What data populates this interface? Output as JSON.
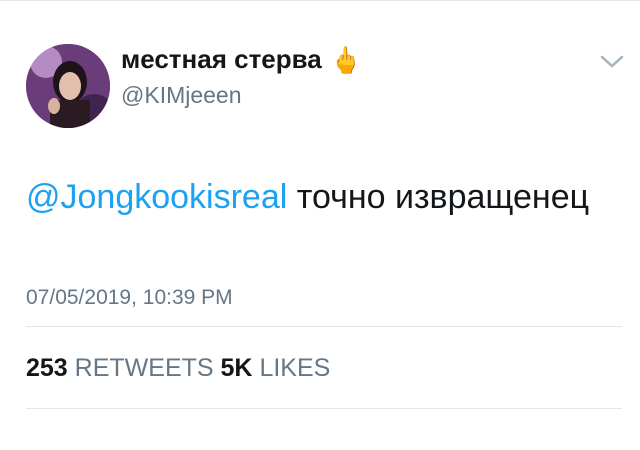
{
  "tweet": {
    "display_name": "местная стерва",
    "name_emoji": "🖕",
    "handle": "@KIMjeeen",
    "mention": "@Jongkookisreal",
    "text_after_mention": " точно извращенец",
    "timestamp": "07/05/2019, 10:39 PM",
    "stats": {
      "retweets_count": "253",
      "retweets_label": "RETWEETS",
      "likes_count": "5K",
      "likes_label": "LIKES"
    }
  },
  "icons": {
    "menu": "chevron-down-icon",
    "avatar": "avatar"
  },
  "colors": {
    "link": "#1da1f2",
    "secondary_text": "#657786",
    "primary_text": "#14171a",
    "divider": "#e1e8ed"
  }
}
